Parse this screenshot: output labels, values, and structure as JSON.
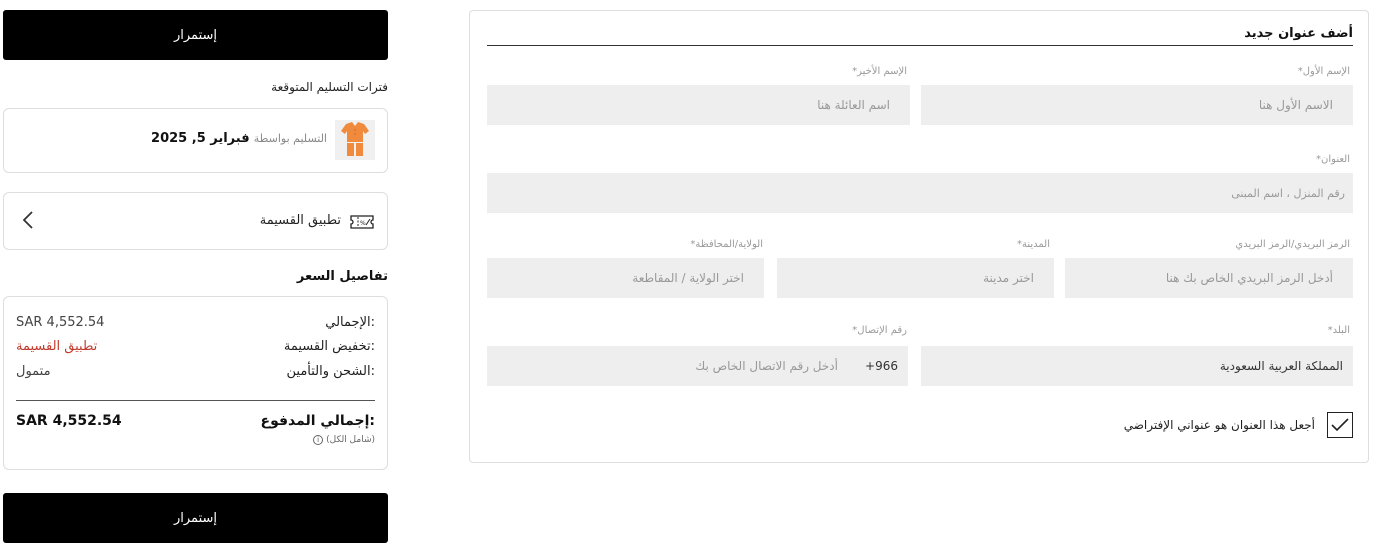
{
  "summary": {
    "continue_top": "إستمرار",
    "delivery_title": "فترات التسليم المتوقعة",
    "delivery_prefix": "التسليم بواسطة",
    "delivery_date": "فبراير 5, 2025",
    "coupon_label": "تطبيق القسيمة",
    "price_title": "تفاصيل السعر",
    "price_rows": [
      {
        "label": "الإجمالي:",
        "value": "SAR 4,552.54"
      },
      {
        "label": "تخفيض القسيمة:",
        "value": "تطبيق القسيمة"
      },
      {
        "label": "الشحن والتأمين:",
        "value": "متمول"
      }
    ],
    "total_label": "إجمالي المدفوع:",
    "total_value": "SAR 4,552.54",
    "total_note": "(شامل الكل)",
    "continue_bottom": "إستمرار"
  },
  "form": {
    "title": "أضف عنوان جديد",
    "first_name": {
      "label": "*الإسم الأول",
      "placeholder": "الاسم الأول هنا"
    },
    "last_name": {
      "label": "*الإسم الأخير",
      "placeholder": "اسم العائلة هنا"
    },
    "address": {
      "label": "*العنوان",
      "placeholder": "رقم المنزل ، اسم المبنى"
    },
    "postal": {
      "label": "الرمز البريدي/الرمز البريدي",
      "placeholder": "أدخل الرمز البريدي الخاص بك هنا"
    },
    "city": {
      "label": "*المدينة",
      "placeholder": "اختر مدينة"
    },
    "state": {
      "label": "*الولاية/المحافظة",
      "placeholder": "اختر الولاية / المقاطعة"
    },
    "country": {
      "label": "*البلد",
      "value": "المملكة العربية السعودية"
    },
    "phone": {
      "label": "*رقم الإتصال",
      "code": "+966",
      "placeholder": "أدخل رقم الاتصال الخاص بك"
    },
    "default_checkbox": {
      "label": "أجعل هذا العنوان هو عنواني الإفتراضي",
      "checked": true
    }
  }
}
